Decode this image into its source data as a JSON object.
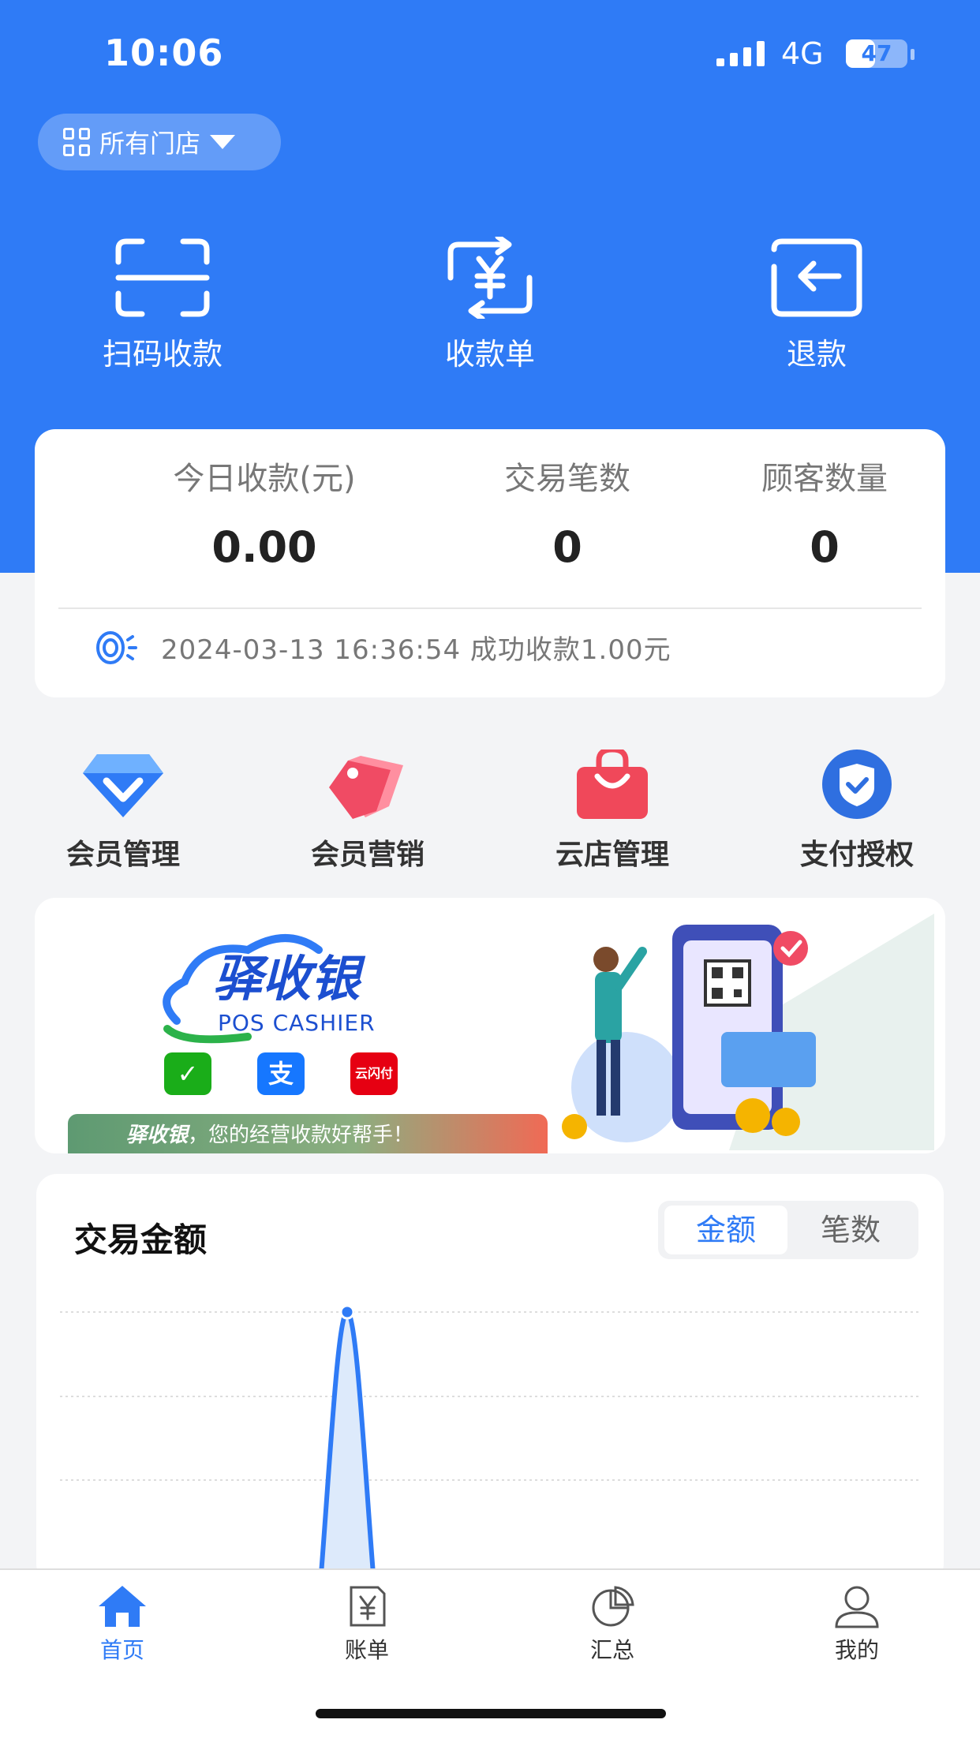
{
  "status_bar": {
    "time": "10:06",
    "network": "4G",
    "battery": "47",
    "battery_level": 0.47
  },
  "header": {
    "store_selector": "所有门店"
  },
  "quick_actions": [
    {
      "label": "扫码收款",
      "icon": "scan-icon"
    },
    {
      "label": "收款单",
      "icon": "yuan-exchange-icon"
    },
    {
      "label": "退款",
      "icon": "refund-icon"
    }
  ],
  "stats": [
    {
      "label": "今日收款(元)",
      "value": "0.00"
    },
    {
      "label": "交易笔数",
      "value": "0"
    },
    {
      "label": "顾客数量",
      "value": "0"
    }
  ],
  "notice": {
    "icon": "speaker-icon",
    "text": "2024-03-13 16:36:54 成功收款1.00元"
  },
  "features": [
    {
      "label": "会员管理",
      "icon": "diamond-icon"
    },
    {
      "label": "会员营销",
      "icon": "tag-icon"
    },
    {
      "label": "云店管理",
      "icon": "shopping-bag-icon"
    },
    {
      "label": "支付授权",
      "icon": "shield-check-icon"
    }
  ],
  "banner": {
    "brand": "驿收银",
    "brand_sub": "POS CASHIER",
    "pay_logos": [
      {
        "name": "wechat-pay-logo",
        "glyph": "✓",
        "color": "#1aad19"
      },
      {
        "name": "alipay-logo",
        "glyph": "支",
        "color": "#1677ff"
      },
      {
        "name": "unionpay-logo",
        "glyph": "云闪付",
        "color": "#e60012"
      }
    ],
    "ribbon_brand": "驿收银",
    "ribbon_text": "，您的经营收款好帮手！"
  },
  "chart_section": {
    "title": "交易金额",
    "toggle_active": "金额",
    "toggle_inactive": "笔数"
  },
  "chart_data": {
    "type": "area",
    "title": "交易金额",
    "grid": true,
    "series": [
      {
        "values": [
          0,
          1.0,
          0
        ]
      }
    ],
    "color": "#2f7bf6"
  },
  "tabbar": [
    {
      "label": "首页",
      "icon": "home-icon",
      "active": true
    },
    {
      "label": "账单",
      "icon": "bill-icon",
      "active": false
    },
    {
      "label": "汇总",
      "icon": "pie-chart-icon",
      "active": false
    },
    {
      "label": "我的",
      "icon": "user-icon",
      "active": false
    }
  ],
  "colors": {
    "primary": "#2f7bf6",
    "background": "#f3f4f6"
  }
}
